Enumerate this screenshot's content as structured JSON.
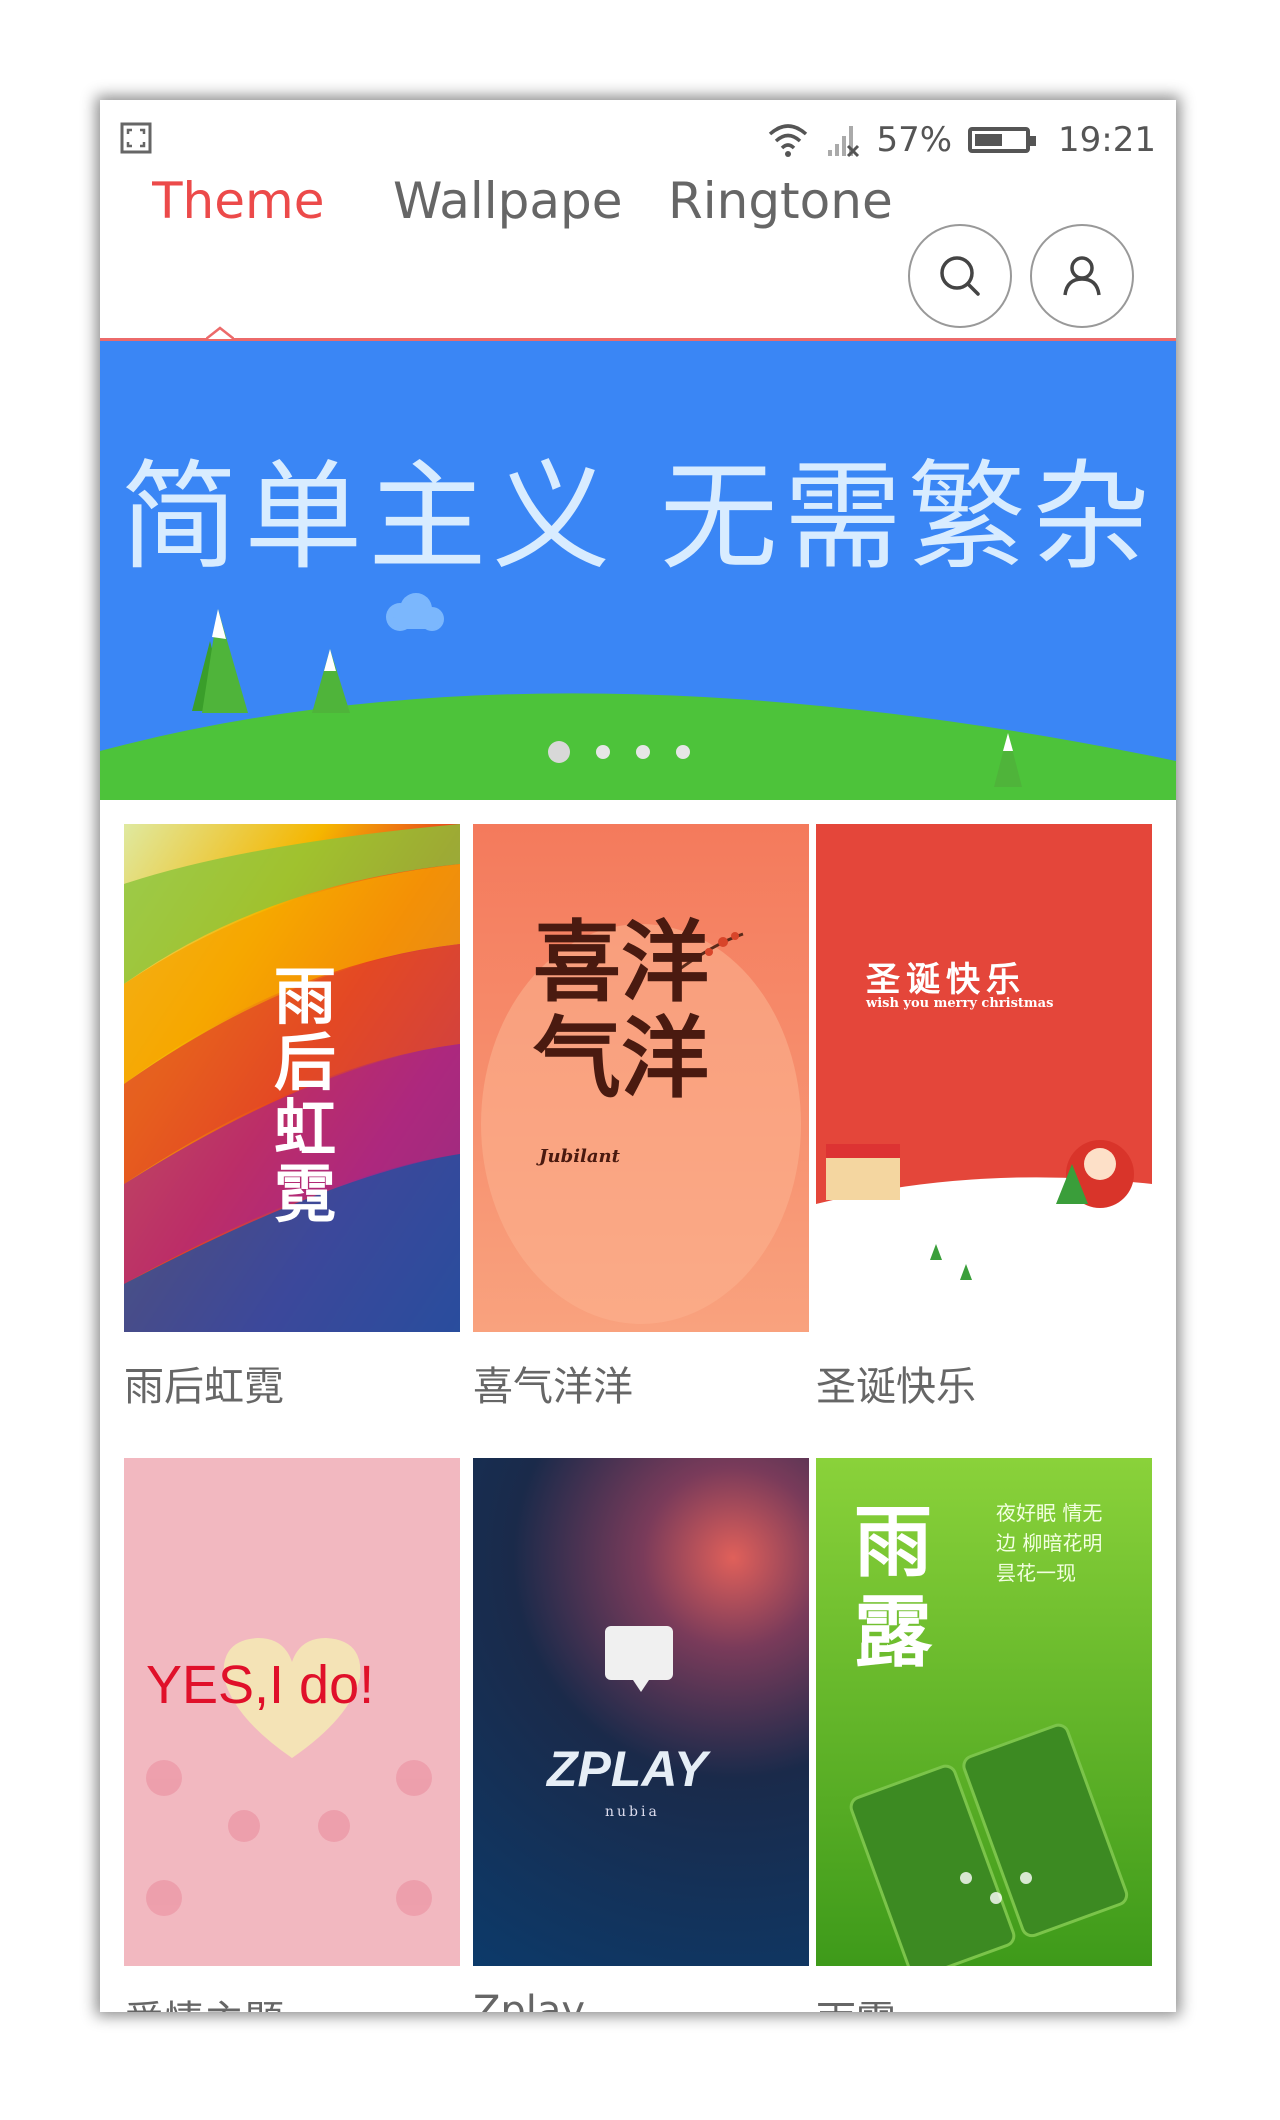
{
  "status_bar": {
    "battery_percent": "57%",
    "battery_level": 0.57,
    "time": "19:21"
  },
  "tabs": [
    {
      "label": "Theme",
      "active": true
    },
    {
      "label": "Wallpaper",
      "active": false
    },
    {
      "label": "Ringtone",
      "active": false
    }
  ],
  "icons": {
    "search": "search-icon",
    "user": "user-icon",
    "screenshot": "screenshot-icon",
    "wifi": "wifi-icon",
    "signal": "signal-icon"
  },
  "banner": {
    "text": "简单主义 无需繁杂",
    "page_count": 4,
    "current_page": 1,
    "color": "#3a86f5"
  },
  "themes": [
    {
      "title": "雨后虹霓",
      "art_text": "雨后虹霓"
    },
    {
      "title": "喜气洋洋",
      "art_text": "喜洋气洋",
      "art_sub": "Jubilant"
    },
    {
      "title": "圣诞快乐",
      "art_text": "圣诞快乐",
      "art_sub": "wish you merry christmas"
    },
    {
      "title": "爱情主题",
      "art_text": "YES,I do!"
    },
    {
      "title": "Zplay",
      "art_text": "ZPLAY",
      "art_sub": "nubia"
    },
    {
      "title": "雨露",
      "art_text": "雨露",
      "art_sub": "夜好眠 情无边 柳暗花明 昙花一现"
    }
  ],
  "colors": {
    "accent": "#ec4a4a",
    "tab_text": "#666666"
  }
}
